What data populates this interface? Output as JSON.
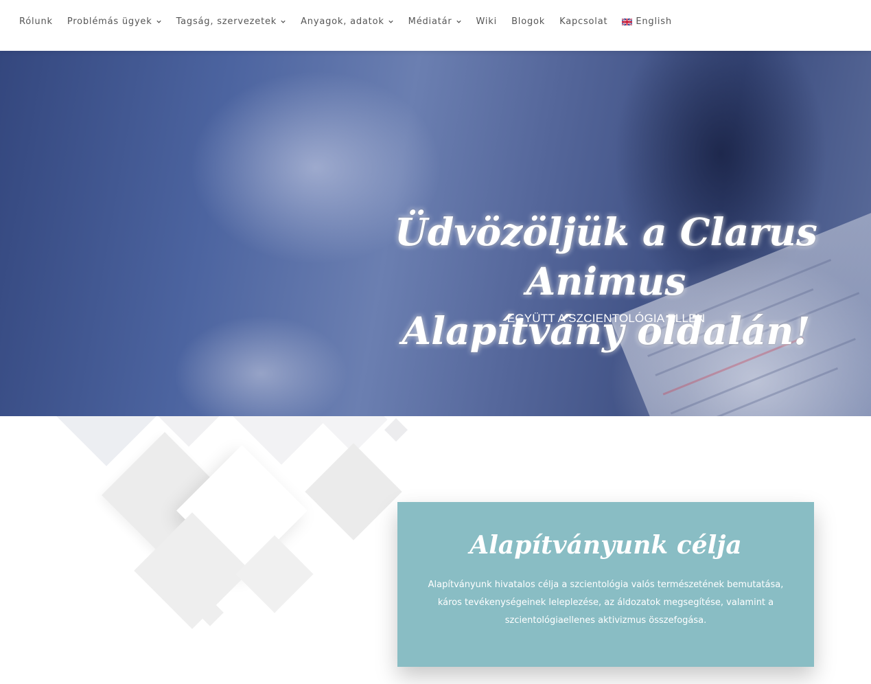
{
  "nav": {
    "items": [
      {
        "label": "Rólunk",
        "dropdown": false
      },
      {
        "label": "Problémás ügyek",
        "dropdown": true
      },
      {
        "label": "Tagság, szervezetek",
        "dropdown": true
      },
      {
        "label": "Anyagok, adatok",
        "dropdown": true
      },
      {
        "label": "Médiatár",
        "dropdown": true
      },
      {
        "label": "Wiki",
        "dropdown": false
      },
      {
        "label": "Blogok",
        "dropdown": false
      },
      {
        "label": "Kapcsolat",
        "dropdown": false
      }
    ],
    "language_label": "English",
    "language_icon": "uk-flag-icon"
  },
  "hero": {
    "title_line1": "Üdvözöljük a Clarus Animus",
    "title_line2": "Alapítvány oldalán!",
    "subtitle": "EGYÜTT A SZCIENTOLÓGIA ELLEN"
  },
  "card": {
    "title": "Alapítványunk célja",
    "text": "Alapítványunk hivatalos célja a szcientológia valós természetének bemutatása, káros tevékenységeinek leleplezése, az áldozatok megsegítése, valamint a szcientológiaellenes aktivizmus összefogása."
  },
  "colors": {
    "card_bg": "#89bdc4",
    "nav_text": "#555555",
    "hero_text": "#ffffff"
  }
}
